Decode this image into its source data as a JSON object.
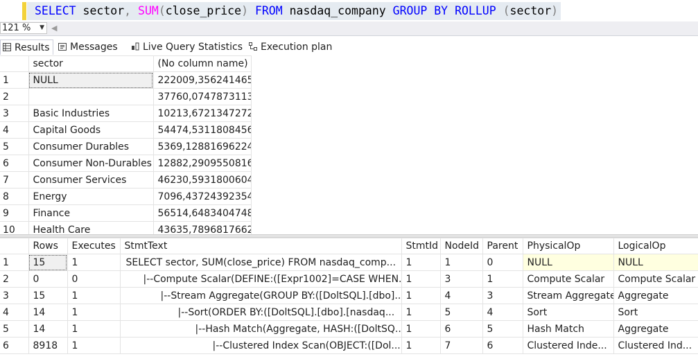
{
  "editor": {
    "sql_tokens": [
      {
        "t": "SELECT",
        "c": "kw"
      },
      {
        "t": " sector",
        "c": "pl"
      },
      {
        "t": ",",
        "c": "op"
      },
      {
        "t": " ",
        "c": "pl"
      },
      {
        "t": "SUM",
        "c": "fn"
      },
      {
        "t": "(",
        "c": "op"
      },
      {
        "t": "close_price",
        "c": "pl"
      },
      {
        "t": ")",
        "c": "op"
      },
      {
        "t": " ",
        "c": "pl"
      },
      {
        "t": "FROM",
        "c": "kw"
      },
      {
        "t": " nasdaq_company ",
        "c": "pl"
      },
      {
        "t": "GROUP BY",
        "c": "kw"
      },
      {
        "t": " ",
        "c": "pl"
      },
      {
        "t": "ROLLUP",
        "c": "kw"
      },
      {
        "t": " ",
        "c": "pl"
      },
      {
        "t": "(",
        "c": "op"
      },
      {
        "t": "sector",
        "c": "pl"
      },
      {
        "t": ")",
        "c": "op"
      }
    ]
  },
  "zoom": {
    "value": "121 %"
  },
  "tabs": [
    {
      "label": "Results",
      "icon": "grid-icon",
      "active": true
    },
    {
      "label": "Messages",
      "icon": "messages-icon",
      "active": false
    },
    {
      "label": "Live Query Statistics",
      "icon": "live-stats-icon",
      "active": false
    },
    {
      "label": "Execution plan",
      "icon": "execution-plan-icon",
      "active": false
    }
  ],
  "results": {
    "columns": [
      "sector",
      "(No column name)"
    ],
    "rows": [
      {
        "n": "1",
        "sector": "NULL",
        "value": "222009,356241465"
      },
      {
        "n": "2",
        "sector": "",
        "value": "37760,0747873113"
      },
      {
        "n": "3",
        "sector": "Basic Industries",
        "value": "10213,6721347272"
      },
      {
        "n": "4",
        "sector": "Capital Goods",
        "value": "54474,5311808456"
      },
      {
        "n": "5",
        "sector": "Consumer Durables",
        "value": "5369,12881696224"
      },
      {
        "n": "6",
        "sector": "Consumer Non-Durables",
        "value": "12882,2909550816"
      },
      {
        "n": "7",
        "sector": "Consumer Services",
        "value": "46230,5931800604"
      },
      {
        "n": "8",
        "sector": "Energy",
        "value": "7096,43724392354"
      },
      {
        "n": "9",
        "sector": "Finance",
        "value": "56514,6483404748"
      },
      {
        "n": "10",
        "sector": "Health Care",
        "value": "43635,7896817662"
      }
    ]
  },
  "plan": {
    "columns": [
      "Rows",
      "Executes",
      "StmtText",
      "StmtId",
      "NodeId",
      "Parent",
      "PhysicalOp",
      "LogicalOp"
    ],
    "rows": [
      {
        "n": "1",
        "rows": "15",
        "executes": "1",
        "stmt": "SELECT sector, SUM(close_price) FROM nasdaq_comp...",
        "indent": 0,
        "stmtid": "1",
        "nodeid": "1",
        "parent": "0",
        "physical": "NULL",
        "logical": "NULL"
      },
      {
        "n": "2",
        "rows": "0",
        "executes": "0",
        "stmt": "|--Compute Scalar(DEFINE:([Expr1002]=CASE WHEN...",
        "indent": 1,
        "stmtid": "1",
        "nodeid": "3",
        "parent": "1",
        "physical": "Compute Scalar",
        "logical": "Compute Scalar"
      },
      {
        "n": "3",
        "rows": "15",
        "executes": "1",
        "stmt": "|--Stream Aggregate(GROUP BY:([DoltSQL].[dbo]....",
        "indent": 2,
        "stmtid": "1",
        "nodeid": "4",
        "parent": "3",
        "physical": "Stream Aggregate",
        "logical": "Aggregate"
      },
      {
        "n": "4",
        "rows": "14",
        "executes": "1",
        "stmt": "|--Sort(ORDER BY:([DoltSQL].[dbo].[nasdaq...",
        "indent": 3,
        "stmtid": "1",
        "nodeid": "5",
        "parent": "4",
        "physical": "Sort",
        "logical": "Sort"
      },
      {
        "n": "5",
        "rows": "14",
        "executes": "1",
        "stmt": "|--Hash Match(Aggregate, HASH:([DoltSQ...",
        "indent": 4,
        "stmtid": "1",
        "nodeid": "6",
        "parent": "5",
        "physical": "Hash Match",
        "logical": "Aggregate"
      },
      {
        "n": "6",
        "rows": "8918",
        "executes": "1",
        "stmt": "|--Clustered Index Scan(OBJECT:([Dol...",
        "indent": 5,
        "stmtid": "1",
        "nodeid": "7",
        "parent": "6",
        "physical": "Clustered Inde...",
        "logical": "Clustered Ind..."
      }
    ]
  }
}
